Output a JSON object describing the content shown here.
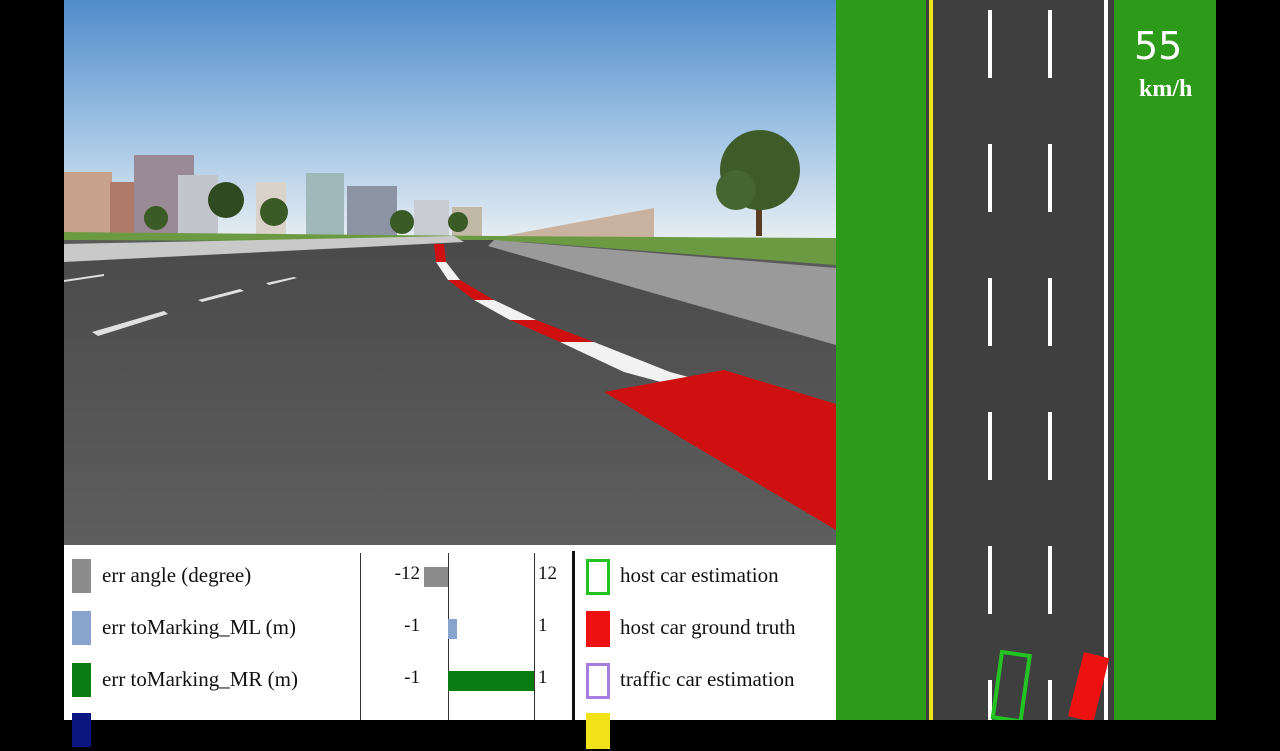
{
  "speed": {
    "value": "55",
    "unit": "km/h"
  },
  "errors": [
    {
      "label": "err angle (degree)",
      "min": "-12",
      "max": "12",
      "value": -3.4,
      "color": "#8c8c8c"
    },
    {
      "label": "err toMarking_ML (m)",
      "min": "-1",
      "max": "1",
      "value": 0.1,
      "color": "#88a4cc"
    },
    {
      "label": "err toMarking_MR (m)",
      "min": "-1",
      "max": "1",
      "value": 1.0,
      "color": "#0a7d12"
    },
    {
      "label": "",
      "min": "",
      "max": "",
      "value": 0,
      "color": "#0b1680"
    }
  ],
  "legend": [
    {
      "label": "host car estimation",
      "color": "#22c422",
      "style": "outline"
    },
    {
      "label": "host car ground truth",
      "color": "#ee1111",
      "style": "filled"
    },
    {
      "label": "traffic car estimation",
      "color": "#a77ee0",
      "style": "outline"
    },
    {
      "label": "",
      "color": "#f2e21a",
      "style": "filled"
    }
  ],
  "colors": {
    "grass": "#2e9a1a",
    "asphalt": "#3f3f3f",
    "lane_marking": "#ffffff",
    "edge_line": "#f2e21a"
  }
}
